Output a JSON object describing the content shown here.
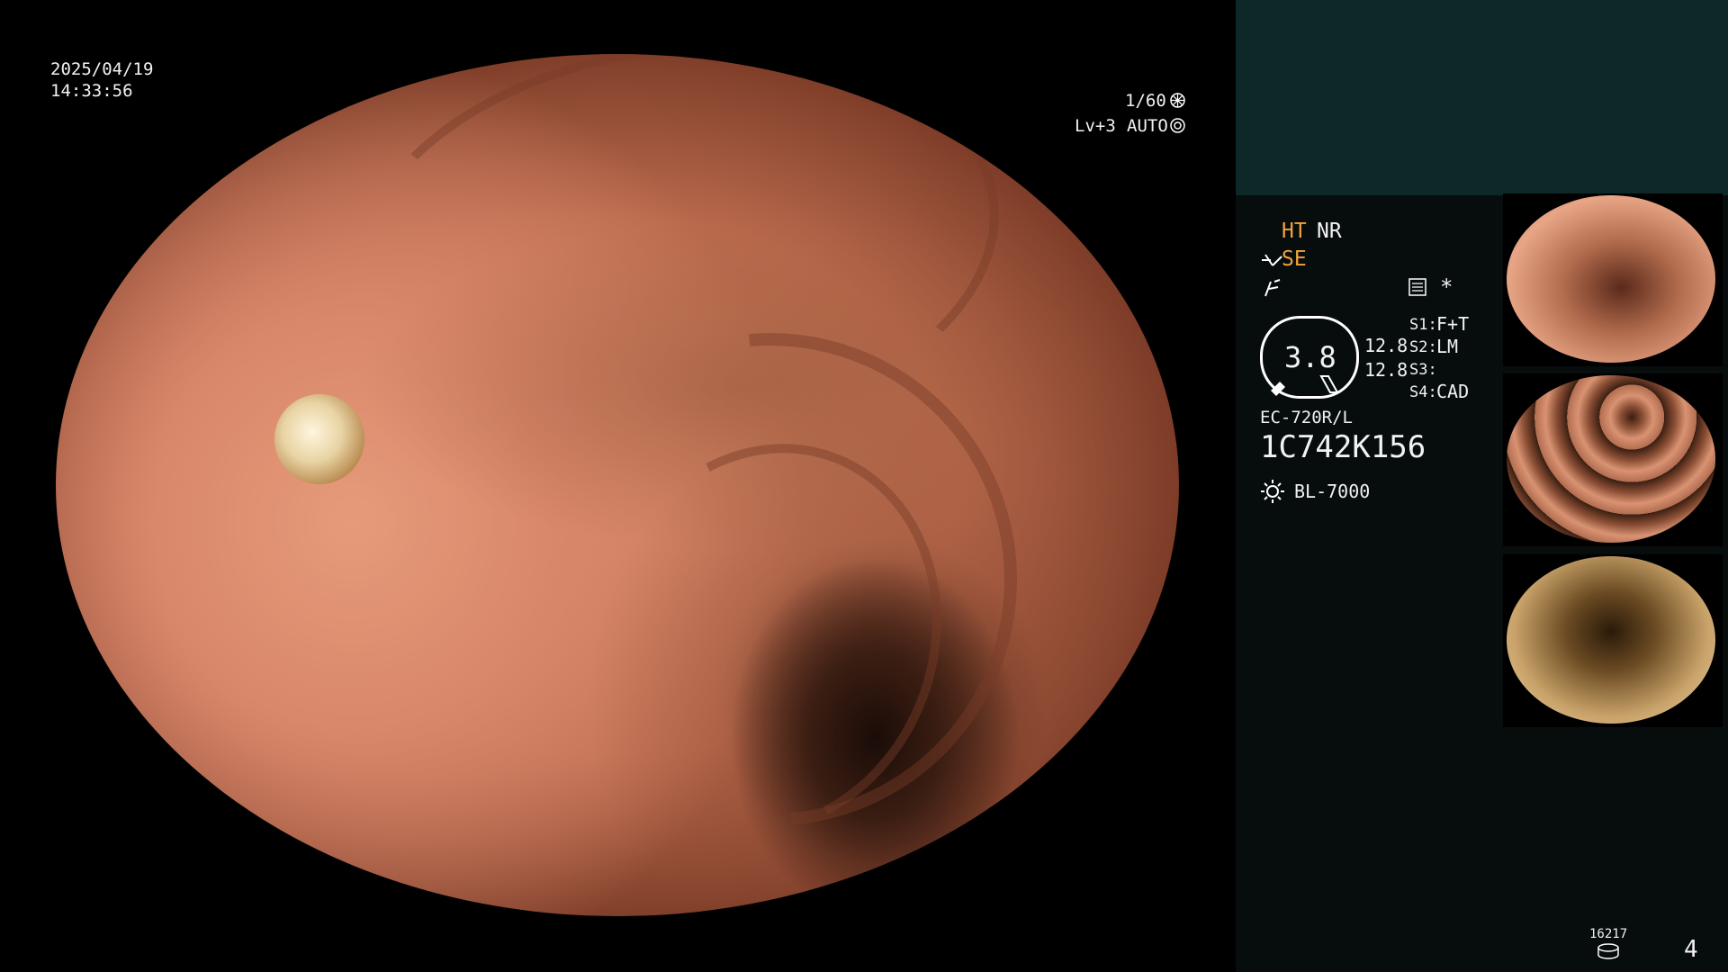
{
  "overlay": {
    "date": "2025/04/19",
    "time": "14:33:56",
    "shutter": "1/60",
    "shutter_icon": "shutter-icon",
    "level": "Lv+3",
    "mode": "AUTO",
    "mode_icon": "auto-iris-icon"
  },
  "settings": {
    "ht": "HT",
    "nr": "NR",
    "se": "SE",
    "s1_key": "S1:",
    "s1_val": "F+T",
    "s2_key": "S2:",
    "s2_val": "LM",
    "s3_key": "S3:",
    "s3_val": "",
    "s4_key": "S4:",
    "s4_val": "CAD",
    "asterisk": "*",
    "gauge_value": "3.8",
    "gauge_r1": "12.8",
    "gauge_r2": "12.8"
  },
  "device": {
    "model": "EC-720R/L",
    "serial": "1C742K156",
    "light_source": "BL-7000"
  },
  "footer": {
    "counter": "16217",
    "page": "4"
  },
  "colors": {
    "accent_orange": "#f2a33a",
    "panel_top": "#0c2928",
    "panel_bg": "#070d0d"
  }
}
